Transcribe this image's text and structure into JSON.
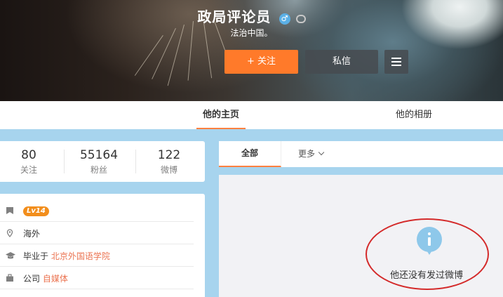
{
  "profile": {
    "name": "政局评论员",
    "bio": "法治中国。",
    "follow_label": "+ 关注",
    "message_label": "私信"
  },
  "tabs": {
    "home": "他的主页",
    "album": "他的相册"
  },
  "stats": [
    {
      "value": "80",
      "label": "关注"
    },
    {
      "value": "55164",
      "label": "粉丝"
    },
    {
      "value": "122",
      "label": "微博"
    }
  ],
  "info": {
    "level": "Lv14",
    "location": "海外",
    "education_prefix": "毕业于",
    "education_school": "北京外国语学院",
    "company_prefix": "公司",
    "company_name": "自媒体"
  },
  "feed": {
    "tab_all": "全部",
    "tab_more": "更多",
    "empty_text": "他还没有发过微博"
  },
  "icons": [
    "male-icon",
    "vip-icon",
    "menu-icon",
    "level-icon",
    "location-icon",
    "education-icon",
    "company-icon",
    "info-icon",
    "chevron-down-icon"
  ],
  "colors": {
    "accent": "#ff8140",
    "follow_button": "#ff7a2a",
    "link": "#eb7350",
    "level_badge": "#f28e1c",
    "annotation": "#d42a2a"
  }
}
